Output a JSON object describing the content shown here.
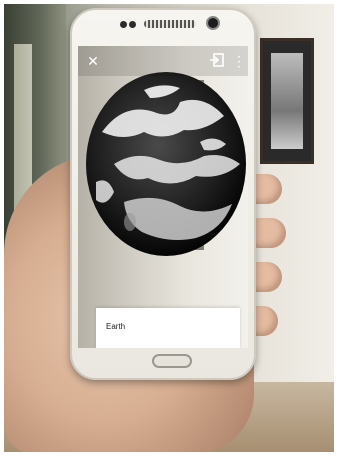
{
  "ar_view": {
    "object_label": "Earth",
    "icons": {
      "close": "close-icon",
      "exit_ar": "exit-ar-icon",
      "more": "more-vert-icon"
    }
  }
}
